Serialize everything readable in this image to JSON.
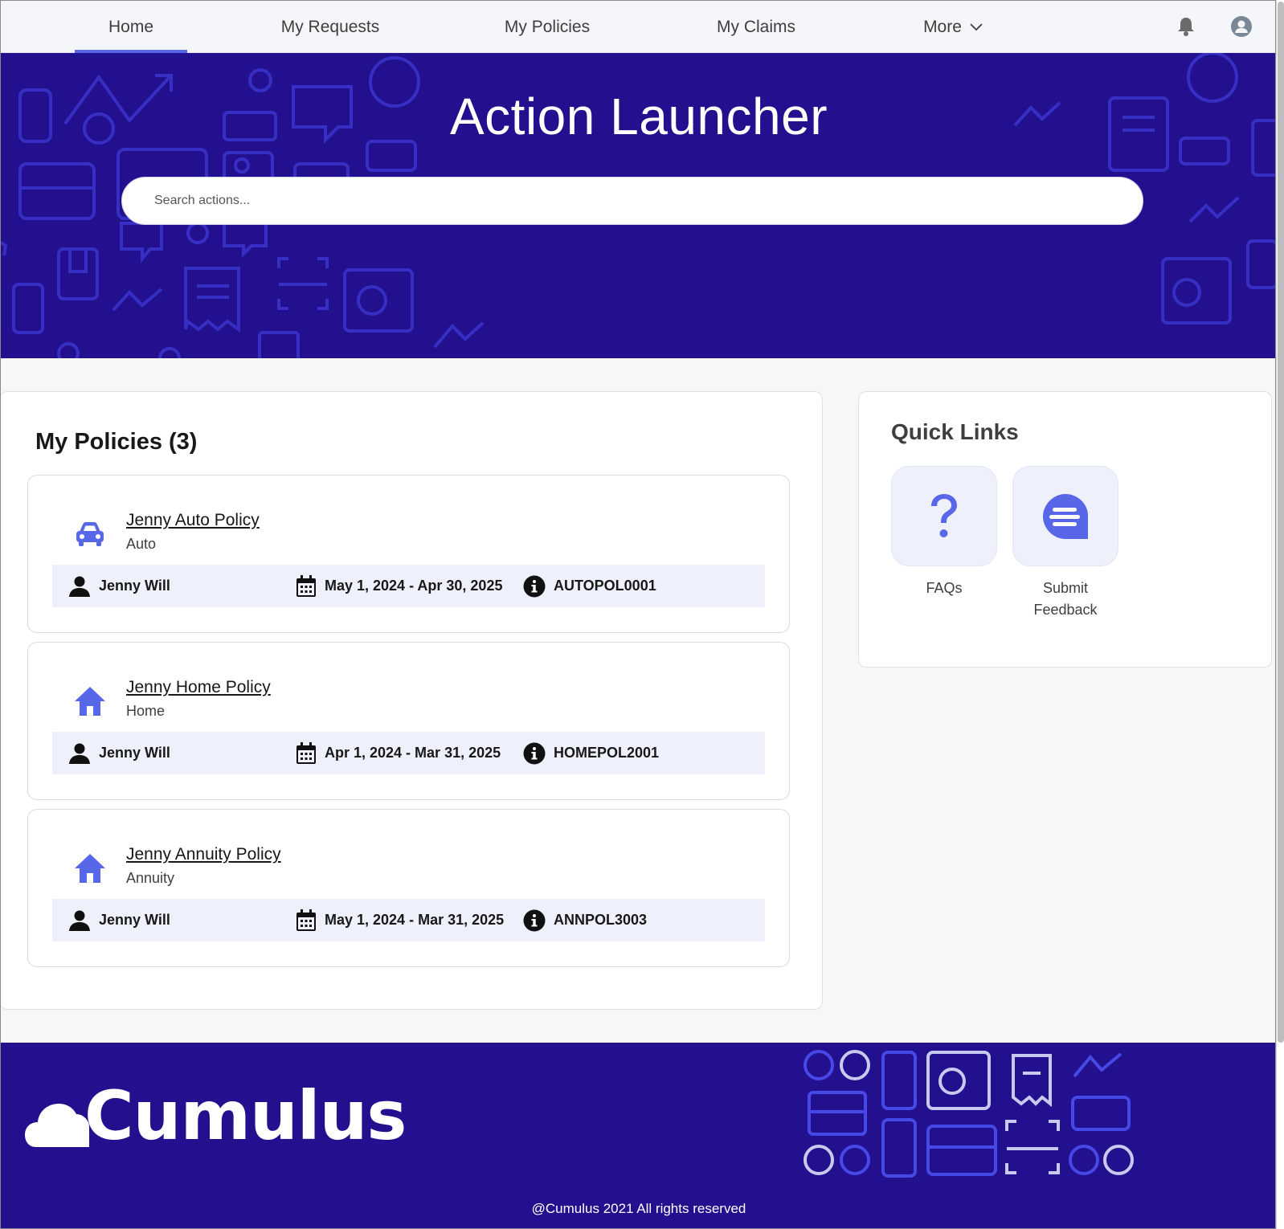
{
  "nav": {
    "items": [
      {
        "label": "Home",
        "active": true
      },
      {
        "label": "My Requests"
      },
      {
        "label": "My Policies"
      },
      {
        "label": "My Claims"
      },
      {
        "label": "More"
      }
    ],
    "icons": [
      "bell-icon",
      "user-avatar-icon"
    ]
  },
  "hero": {
    "title": "Action Launcher",
    "search_placeholder": "Search actions..."
  },
  "policies": {
    "title": "My Policies (3)",
    "items": [
      {
        "name": "Jenny Auto Policy",
        "type": "Auto",
        "icon": "car-icon",
        "holder": "Jenny Will",
        "dates": "May 1, 2024 - Apr 30, 2025",
        "number": "AUTOPOL0001"
      },
      {
        "name": "Jenny Home Policy",
        "type": "Home",
        "icon": "home-icon",
        "holder": "Jenny Will",
        "dates": "Apr 1, 2024 - Mar 31, 2025",
        "number": "HOMEPOL2001"
      },
      {
        "name": "Jenny Annuity Policy",
        "type": "Annuity",
        "icon": "home-icon",
        "holder": "Jenny Will",
        "dates": "May 1, 2024 - Mar 31, 2025",
        "number": "ANNPOL3003"
      }
    ]
  },
  "quick_links": {
    "title": "Quick Links",
    "items": [
      {
        "label": "FAQs",
        "icon": "question-icon"
      },
      {
        "label": "Submit Feedback",
        "icon": "chat-icon"
      }
    ]
  },
  "footer": {
    "logo_text": "Cumulus",
    "copyright": "@Cumulus 2021 All rights reserved"
  },
  "colors": {
    "brand": "#22108e",
    "accent": "#5867e8",
    "bar": "#eef1fb"
  }
}
